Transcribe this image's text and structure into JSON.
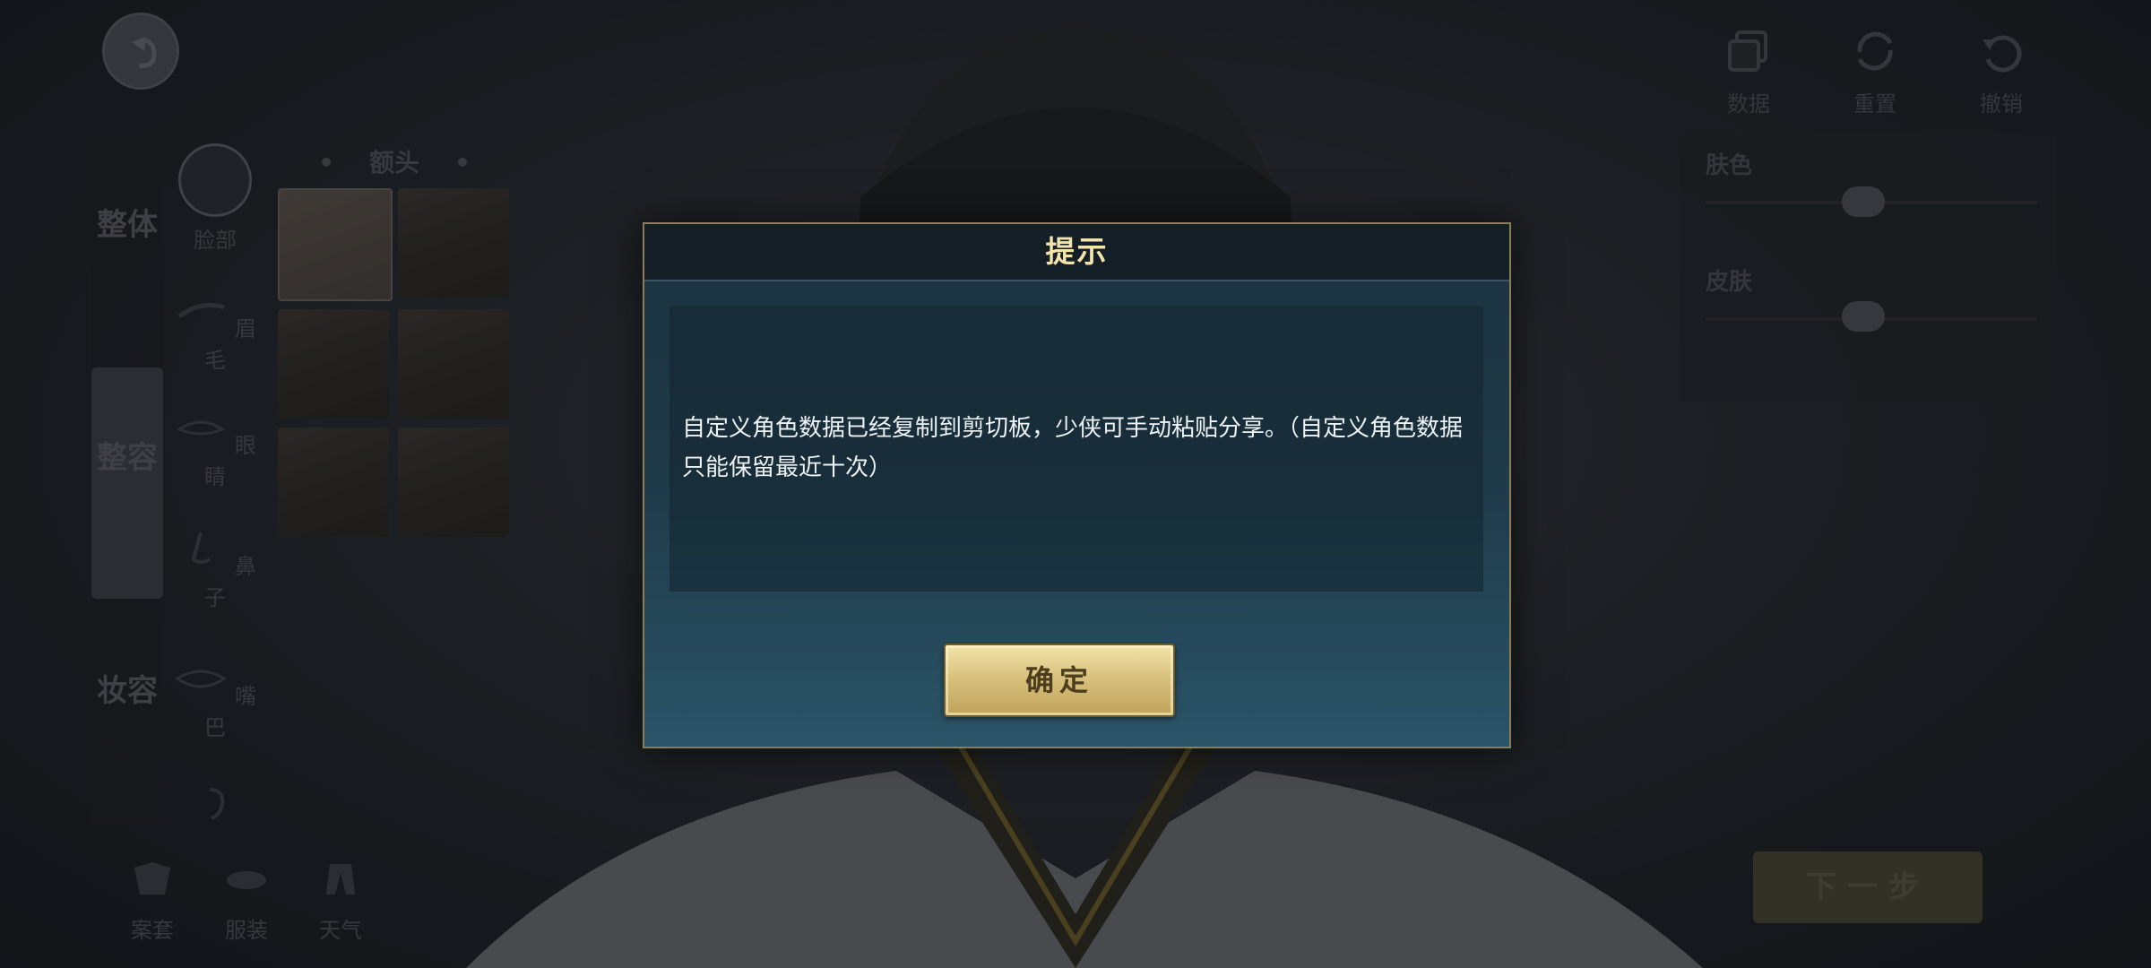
{
  "left_strip": {
    "tabs": [
      "整体",
      "整容",
      "妆容"
    ]
  },
  "feature_column": {
    "items": [
      "脸部",
      "眉毛",
      "眼睛",
      "鼻子",
      "嘴巴"
    ]
  },
  "preset_panel": {
    "header": "额头",
    "preset_count": 6
  },
  "bottom_tools": {
    "items": [
      "案套",
      "服装",
      "天气"
    ]
  },
  "top_right": {
    "buttons": [
      {
        "label": "数据",
        "icon": "copy-icon"
      },
      {
        "label": "重置",
        "icon": "refresh-icon"
      },
      {
        "label": "撤销",
        "icon": "undo-icon"
      }
    ]
  },
  "right_panel": {
    "sliders": [
      {
        "label": "肤色",
        "value": 0.35
      },
      {
        "label": "皮肤",
        "value": 0.35
      }
    ]
  },
  "next_button": {
    "label": "下一步"
  },
  "dialog": {
    "title": "提示",
    "message": "自定义角色数据已经复制到剪切板，少侠可手动粘贴分享。（自定义角色数据只能保留最近十次）",
    "confirm_label": "确定"
  },
  "colors": {
    "dialog_title": "#f3e3ad",
    "dialog_border": "#8a7d5a",
    "confirm_gold": "#d9c27e"
  }
}
